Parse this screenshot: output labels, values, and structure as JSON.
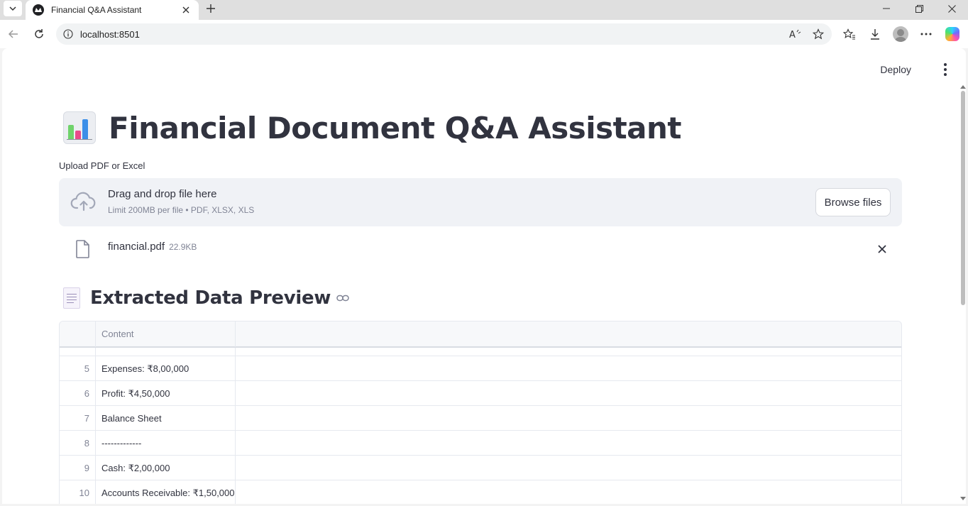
{
  "browser": {
    "tab_title": "Financial Q&A Assistant",
    "url": "localhost:8501"
  },
  "app": {
    "deploy_label": "Deploy",
    "title": "Financial Document Q&A Assistant",
    "title_icon": "bar-chart-emoji",
    "upload": {
      "label": "Upload PDF or Excel",
      "dropzone_title": "Drag and drop file here",
      "dropzone_sub": "Limit 200MB per file • PDF, XLSX, XLS",
      "browse_label": "Browse files"
    },
    "uploaded_file": {
      "name": "financial.pdf",
      "size": "22.9KB"
    },
    "section": {
      "icon": "page-emoji",
      "title": "Extracted Data Preview"
    },
    "table": {
      "columns": [
        "",
        "Content"
      ],
      "rows": [
        {
          "index": "5",
          "content": "Expenses: ₹8,00,000"
        },
        {
          "index": "6",
          "content": "Profit: ₹4,50,000"
        },
        {
          "index": "7",
          "content": "Balance Sheet"
        },
        {
          "index": "8",
          "content": "-------------"
        },
        {
          "index": "9",
          "content": "Cash: ₹2,00,000"
        },
        {
          "index": "10",
          "content": "Accounts Receivable: ₹1,50,000"
        }
      ]
    }
  }
}
